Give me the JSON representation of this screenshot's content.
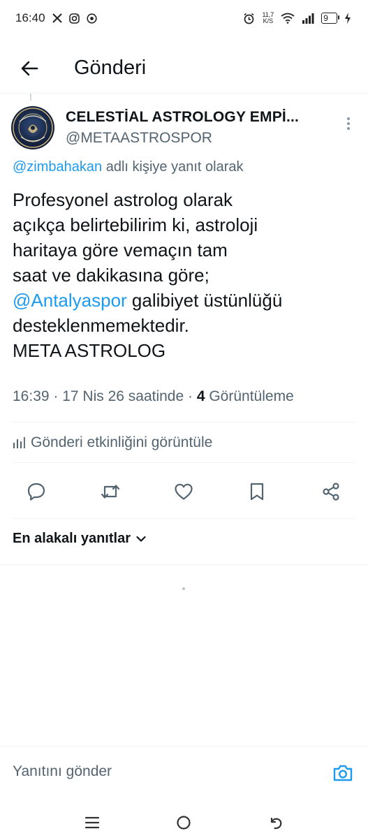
{
  "status_bar": {
    "time": "16:40",
    "net_speed_value": "11,7",
    "net_speed_unit": "K/S",
    "battery": "9",
    "icons": [
      "x-icon",
      "instagram-icon",
      "chrome-icon",
      "alarm-icon",
      "wifi-icon",
      "signal-icon",
      "battery-icon"
    ]
  },
  "header": {
    "title": "Gönderi"
  },
  "post": {
    "author_name": "CELESTİAL ASTROLOGY EMPİ...",
    "author_handle": "@METAASTROSPOR",
    "reply_mention": "@zimbahakan",
    "reply_suffix": " adlı kişiye yanıt olarak",
    "body": {
      "line1": "Profesyonel astrolog olarak",
      "line2": "açıkça belirtebilirim ki, astroloji",
      "line3": "haritaya göre vemaçın tam",
      "line4": "saat ve dakikasına göre;",
      "line5_mention": "@Antalyaspor",
      "line5_rest": " galibiyet üstünlüğü",
      "line6": "desteklenmemektedir.",
      "line7": "META ASTROLOG"
    },
    "timestamp": "16:39 · 17 Nis 26 saatinde · ",
    "views_count": "4",
    "views_label": " Görüntüleme"
  },
  "activity": {
    "label": "Gönderi etkinliğini görüntüle"
  },
  "replies": {
    "sort_label": "En alakalı yanıtlar"
  },
  "compose": {
    "placeholder": "Yanıtını gönder"
  },
  "colors": {
    "accent": "#1d9bf0",
    "text_primary": "#0f1419",
    "text_secondary": "#536471",
    "divider": "#eff3f4"
  }
}
